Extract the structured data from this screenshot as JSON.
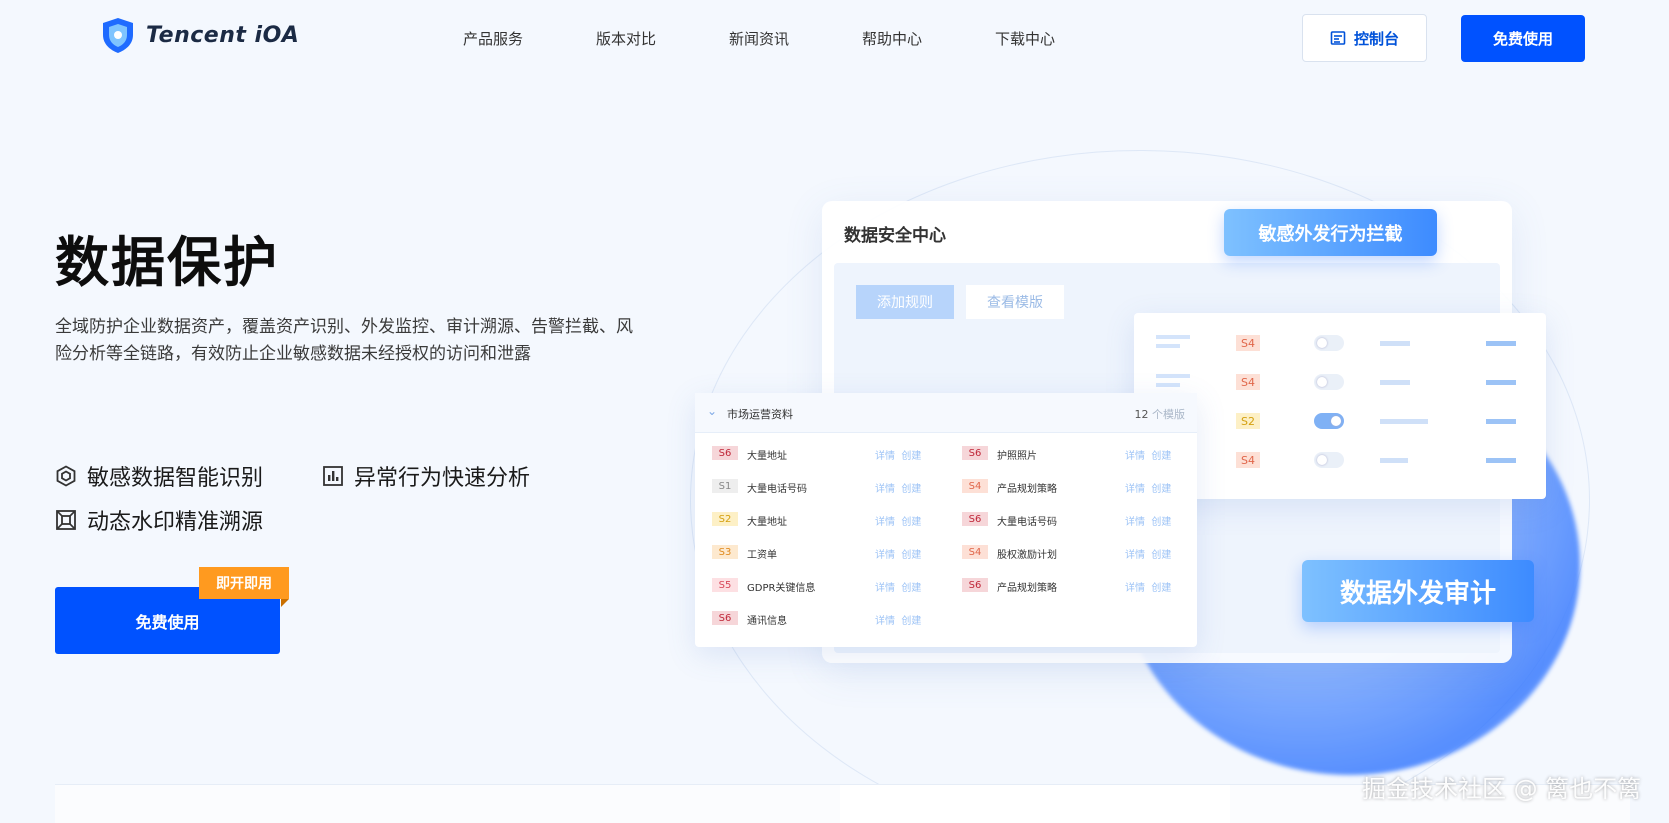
{
  "header": {
    "logo_text": "Tencent iOA",
    "nav": [
      "产品服务",
      "版本对比",
      "新闻资讯",
      "帮助中心",
      "下载中心"
    ],
    "console_label": "控制台",
    "free_label": "免费使用"
  },
  "hero": {
    "title": "数据保护",
    "description": "全域防护企业数据资产，覆盖资产识别、外发监控、审计溯源、告警拦截、风险分析等全链路，有效防止企业敏感数据未经授权的访问和泄露",
    "features": [
      "敏感数据智能识别",
      "异常行为快速分析",
      "动态水印精准溯源"
    ],
    "cta_label": "免费使用",
    "cta_tag": "即开即用"
  },
  "illustration": {
    "panel_title": "数据安全中心",
    "btn_add": "添加规则",
    "btn_template": "查看模版",
    "badge_top": "敏感外发行为拦截",
    "badge_bottom": "数据外发审计",
    "rules": [
      {
        "severity": "S4",
        "enabled": false
      },
      {
        "severity": "S4",
        "enabled": false
      },
      {
        "severity": "S2",
        "enabled": true
      },
      {
        "severity": "S4",
        "enabled": false
      }
    ],
    "list": {
      "title": "市场运营资料",
      "count": "12",
      "count_suffix": "个模版",
      "action_detail": "详情",
      "action_create": "创建",
      "left": [
        {
          "severity": "S6",
          "name": "大量地址"
        },
        {
          "severity": "S1",
          "name": "大量电话号码"
        },
        {
          "severity": "S2",
          "name": "大量地址"
        },
        {
          "severity": "S3",
          "name": "工资单"
        },
        {
          "severity": "S5",
          "name": "GDPR关键信息"
        },
        {
          "severity": "S6",
          "name": "通讯信息"
        }
      ],
      "right": [
        {
          "severity": "S6",
          "name": "护照照片"
        },
        {
          "severity": "S4",
          "name": "产品规划策略"
        },
        {
          "severity": "S6",
          "name": "大量电话号码"
        },
        {
          "severity": "S4",
          "name": "股权激励计划"
        },
        {
          "severity": "S6",
          "name": "产品规划策略"
        }
      ]
    }
  },
  "watermark": "掘金技术社区 @ 篱也不篱",
  "colors": {
    "brand": "#0052ff",
    "accent_tag": "#ff9a1f",
    "bg": "#f4f8fe"
  }
}
